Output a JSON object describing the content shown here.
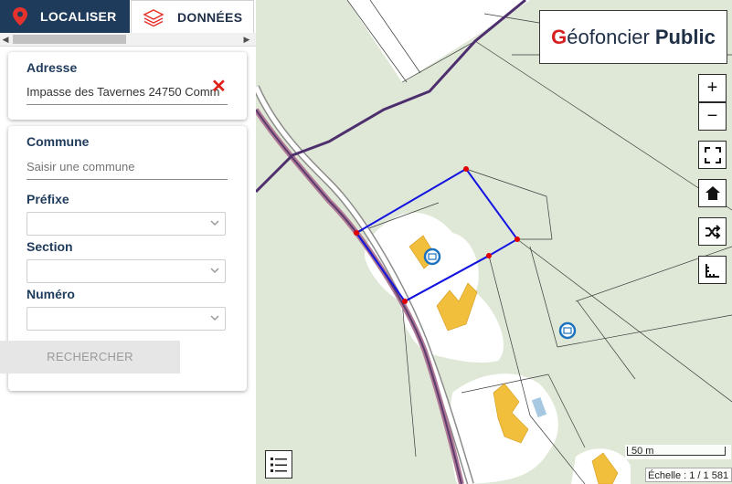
{
  "tabs": [
    {
      "label": "LOCALISER",
      "icon": "map-pin-icon",
      "active": true
    },
    {
      "label": "DONNÉES",
      "icon": "layers-icon",
      "active": false
    }
  ],
  "address": {
    "label": "Adresse",
    "value": "Impasse des Tavernes 24750 Comm"
  },
  "cadastre_form": {
    "commune_label": "Commune",
    "commune_placeholder": "Saisir une commune",
    "prefix_label": "Préfixe",
    "section_label": "Section",
    "numero_label": "Numéro",
    "search_button": "RECHERCHER"
  },
  "logo": {
    "prefix_letter": "G",
    "name_rest": "éofoncier",
    "suffix": "Public"
  },
  "map_controls": {
    "zoom_in": "+",
    "zoom_out": "−"
  },
  "scale": {
    "bar_label": "50 m",
    "ratio_text": "Échelle : 1 / 1 581"
  },
  "colors": {
    "brand_dark": "#1f3b5c",
    "brand_red": "#d42020",
    "parcel_outline": "#1515e0",
    "boundary_purple": "#4e2f6e",
    "road_pink": "#b07a96",
    "buildings": "#f2bf3c",
    "vegetation": "#dfe8d7"
  }
}
